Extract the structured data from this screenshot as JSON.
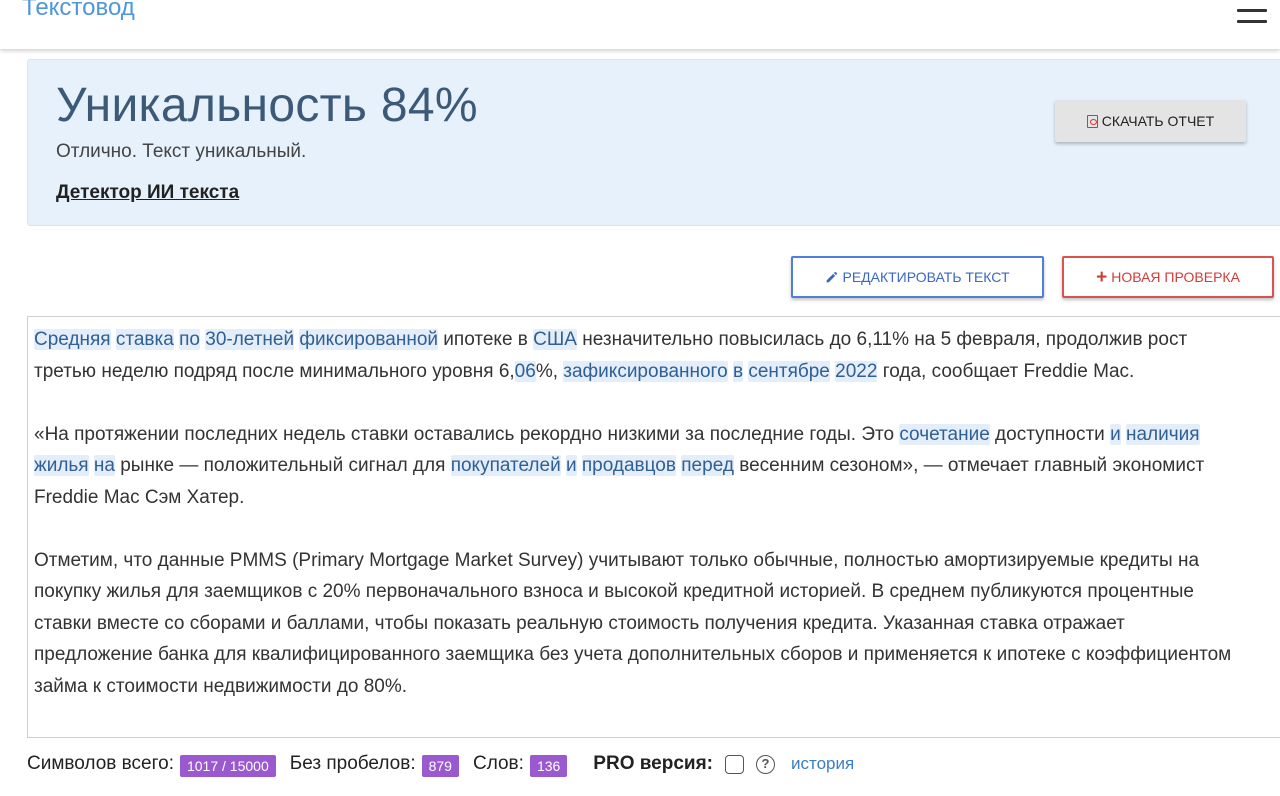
{
  "header": {
    "brand": "Текстовод",
    "menu_icon": "hamburger-icon"
  },
  "result": {
    "title": "Уникальность 84%",
    "uniqueness_percent": 84,
    "subtitle": "Отлично. Текст уникальный.",
    "ai_detector_link": "Детектор ИИ текста",
    "download_label": "СКАЧАТЬ ОТЧЕТ",
    "download_icon": "pdf-file-icon"
  },
  "actions": {
    "edit_label": "РЕДАКТИРОВАТЬ ТЕКСТ",
    "edit_icon": "pencil-icon",
    "new_check_label": "НОВАЯ ПРОВЕРКА",
    "new_check_icon": "plus-icon"
  },
  "text": {
    "paragraphs": [
      [
        [
          {
            "t": "Средняя",
            "hl": true
          },
          {
            "t": " ",
            "hl": false
          },
          {
            "t": "ставка",
            "hl": true
          },
          {
            "t": " ",
            "hl": false
          },
          {
            "t": "по",
            "hl": true
          },
          {
            "t": " ",
            "hl": false
          },
          {
            "t": "30-летней",
            "hl": true
          },
          {
            "t": " ",
            "hl": false
          },
          {
            "t": "фиксированной",
            "hl": true
          },
          {
            "t": " ипотеке в ",
            "hl": false
          },
          {
            "t": "США",
            "hl": true
          },
          {
            "t": " незначительно повысилась до 6,11% на 5 февраля, продолжив рост",
            "hl": false
          }
        ],
        [
          {
            "t": "третью неделю подряд после минимального уровня 6,",
            "hl": false
          },
          {
            "t": "06",
            "hl": true
          },
          {
            "t": "%, ",
            "hl": false
          },
          {
            "t": "зафиксированного",
            "hl": true
          },
          {
            "t": " ",
            "hl": false
          },
          {
            "t": "в",
            "hl": true
          },
          {
            "t": " ",
            "hl": false
          },
          {
            "t": "сентябре",
            "hl": true
          },
          {
            "t": " ",
            "hl": false
          },
          {
            "t": "2022",
            "hl": true
          },
          {
            "t": " года, сообщает Freddie Mac.",
            "hl": false
          }
        ]
      ],
      [
        [
          {
            "t": "«На протяжении последних недель ставки оставались рекордно низкими за последние годы. Это ",
            "hl": false
          },
          {
            "t": "сочетание",
            "hl": true
          },
          {
            "t": " доступности ",
            "hl": false
          },
          {
            "t": "и",
            "hl": true
          },
          {
            "t": " ",
            "hl": false
          },
          {
            "t": "наличия",
            "hl": true
          }
        ],
        [
          {
            "t": "жилья",
            "hl": true
          },
          {
            "t": " ",
            "hl": false
          },
          {
            "t": "на",
            "hl": true
          },
          {
            "t": " рынке — положительный сигнал для ",
            "hl": false
          },
          {
            "t": "покупателей",
            "hl": true
          },
          {
            "t": " ",
            "hl": false
          },
          {
            "t": "и",
            "hl": true
          },
          {
            "t": " ",
            "hl": false
          },
          {
            "t": "продавцов",
            "hl": true
          },
          {
            "t": " ",
            "hl": false
          },
          {
            "t": "перед",
            "hl": true
          },
          {
            "t": " весенним сезоном», — отмечает главный экономист",
            "hl": false
          }
        ],
        [
          {
            "t": "Freddie Mac Сэм Хатер.",
            "hl": false
          }
        ]
      ],
      [
        [
          {
            "t": "Отметим, что данные PMMS (Primary Mortgage Market Survey) учитывают только обычные, полностью амортизируемые кредиты на",
            "hl": false
          }
        ],
        [
          {
            "t": "покупку жилья для заемщиков с 20% первоначального взноса и высокой кредитной историей. В среднем публикуются процентные",
            "hl": false
          }
        ],
        [
          {
            "t": "ставки вместе со сборами и баллами, чтобы показать реальную стоимость получения кредита. Указанная ставка отражает",
            "hl": false
          }
        ],
        [
          {
            "t": "предложение банка для квалифицированного заемщика без учета дополнительных сборов и применяется к ипотеке с коэффициентом",
            "hl": false
          }
        ],
        [
          {
            "t": "займа к стоимости недвижимости до 80%.",
            "hl": false
          }
        ]
      ]
    ]
  },
  "footer": {
    "chars_label": "Символов всего:",
    "chars_value": "1017 / 15000",
    "no_spaces_label": "Без пробелов:",
    "no_spaces_value": "879",
    "words_label": "Слов:",
    "words_value": "136",
    "pro_label": "PRO версия:",
    "pro_checked": false,
    "help_icon": "question-circle-icon",
    "history_link": "история"
  },
  "colors": {
    "brand": "#4f96dc",
    "result_bg": "#e6f1fb",
    "highlight_bg": "#e3eefa",
    "edit_border": "#4f7fdc",
    "new_border": "#d9534f",
    "badge": "#9b59d0"
  }
}
